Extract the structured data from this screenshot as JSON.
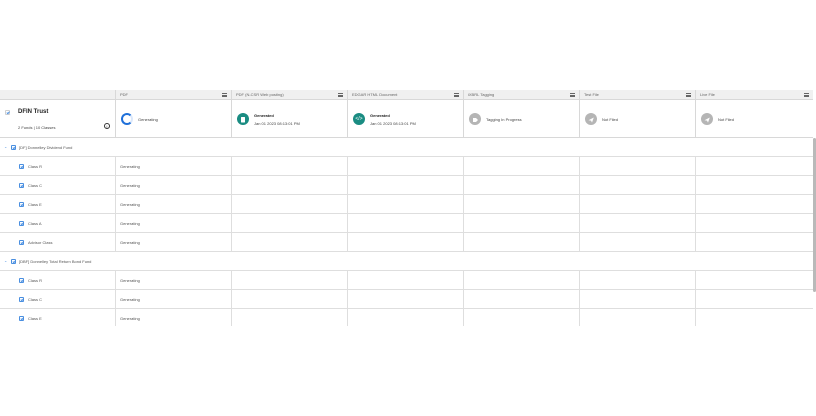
{
  "columns": [
    {
      "label": "PDF"
    },
    {
      "label": "PDF (N-CSR Web posting)"
    },
    {
      "label": "EDGAR HTML Document"
    },
    {
      "label": "iXBRL Tagging"
    },
    {
      "label": "Test File"
    },
    {
      "label": "Live File"
    }
  ],
  "trust": {
    "name": "DFIN Trust",
    "summary": "2 Funds | 10 Classes"
  },
  "statuses": [
    {
      "title": "Generating",
      "date": ""
    },
    {
      "title": "Generated",
      "date": "Jan 01 2023 08:13:01 PM"
    },
    {
      "title": "Generated",
      "date": "Jan 01 2023 08:13:01 PM"
    },
    {
      "title": "Tagging In Progress",
      "date": ""
    },
    {
      "title": "Not Filed",
      "date": ""
    },
    {
      "title": "Not Filed",
      "date": ""
    }
  ],
  "funds": [
    {
      "name": "[DF] Donnelley Dividend Fund",
      "classes": [
        {
          "name": "Class R",
          "pdf": "Generating"
        },
        {
          "name": "Class C",
          "pdf": "Generating"
        },
        {
          "name": "Class E",
          "pdf": "Generating"
        },
        {
          "name": "Class A",
          "pdf": "Generating"
        },
        {
          "name": "Advisor Class",
          "pdf": "Generating"
        }
      ]
    },
    {
      "name": "[DBF] Donnelley Total Return Bond Fund",
      "classes": [
        {
          "name": "Class R",
          "pdf": "Generating"
        },
        {
          "name": "Class C",
          "pdf": "Generating"
        },
        {
          "name": "Class E",
          "pdf": "Generating"
        }
      ]
    }
  ],
  "icons": {
    "generating": "progress-ring-icon",
    "generated": "document-icon",
    "html": "code-icon",
    "tagging": "tag-icon",
    "filing": "send-icon",
    "info": "info-icon"
  },
  "colors": {
    "teal": "#1a8c82",
    "blue": "#1e6fd9",
    "grey": "#b5b5b5"
  }
}
